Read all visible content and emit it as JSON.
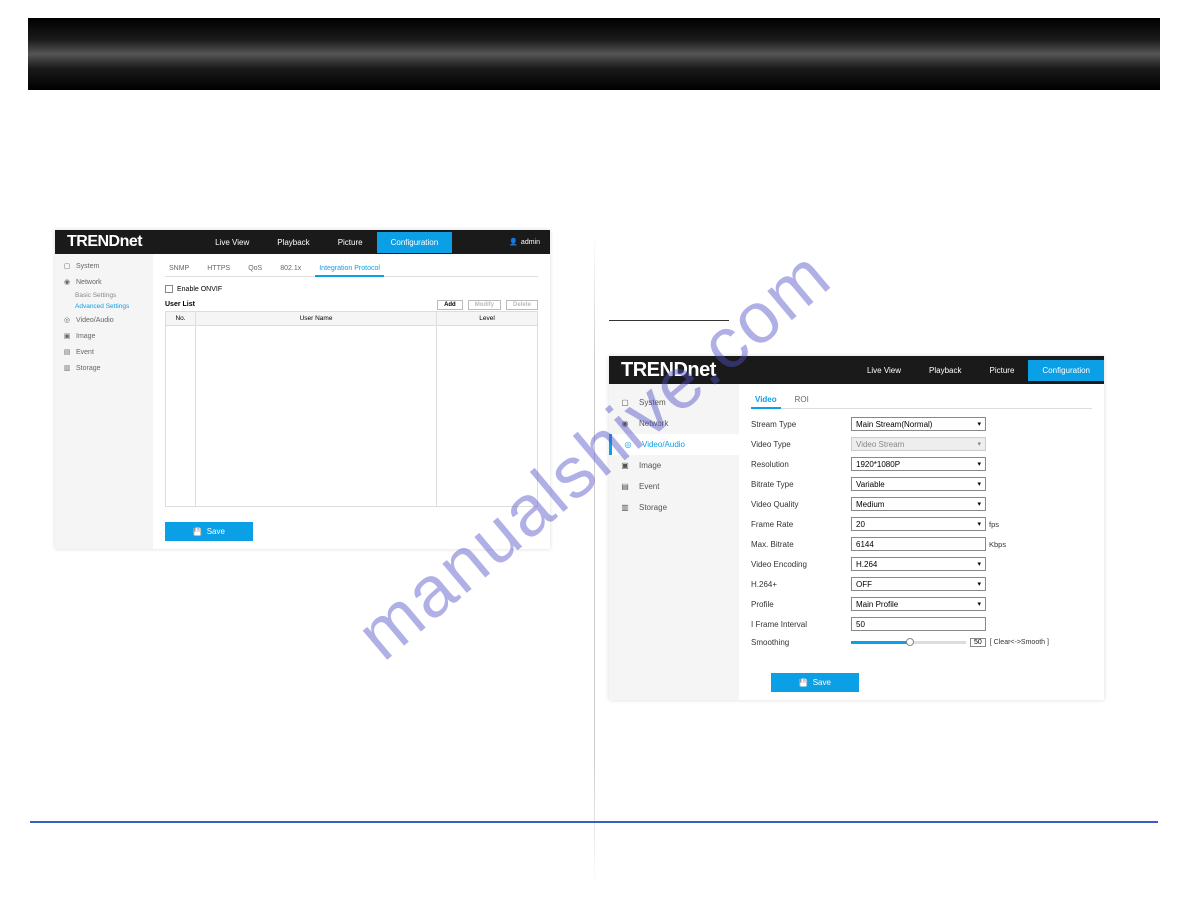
{
  "watermark_text": "manualshive.com",
  "brand_name": "TRENDnet",
  "header_tabs": {
    "live_view": "Live View",
    "playback": "Playback",
    "picture": "Picture",
    "configuration": "Configuration"
  },
  "user_label": "admin",
  "left_screenshot": {
    "sidebar": {
      "system": "System",
      "network": "Network",
      "basic_settings": "Basic Settings",
      "advanced_settings": "Advanced Settings",
      "video_audio": "Video/Audio",
      "image": "Image",
      "event": "Event",
      "storage": "Storage"
    },
    "subtabs": {
      "snmp": "SNMP",
      "https": "HTTPS",
      "qos": "QoS",
      "dot1x": "802.1x",
      "integration": "Integration Protocol"
    },
    "enable_onvif": "Enable ONVIF",
    "user_list_label": "User List",
    "add_btn": "Add",
    "modify_btn": "Modify",
    "delete_btn": "Delete",
    "table": {
      "no": "No.",
      "username": "User Name",
      "level": "Level"
    },
    "save": "Save"
  },
  "right_screenshot": {
    "sidebar": {
      "system": "System",
      "network": "Network",
      "video_audio": "Video/Audio",
      "image": "Image",
      "event": "Event",
      "storage": "Storage"
    },
    "subtabs": {
      "video": "Video",
      "roi": "ROI"
    },
    "form": {
      "stream_type": {
        "label": "Stream Type",
        "value": "Main Stream(Normal)"
      },
      "video_type": {
        "label": "Video Type",
        "value": "Video Stream"
      },
      "resolution": {
        "label": "Resolution",
        "value": "1920*1080P"
      },
      "bitrate_type": {
        "label": "Bitrate Type",
        "value": "Variable"
      },
      "video_quality": {
        "label": "Video Quality",
        "value": "Medium"
      },
      "frame_rate": {
        "label": "Frame Rate",
        "value": "20",
        "unit": "fps"
      },
      "max_bitrate": {
        "label": "Max. Bitrate",
        "value": "6144",
        "unit": "Kbps"
      },
      "video_encoding": {
        "label": "Video Encoding",
        "value": "H.264"
      },
      "h264plus": {
        "label": "H.264+",
        "value": "OFF"
      },
      "profile": {
        "label": "Profile",
        "value": "Main Profile"
      },
      "iframe": {
        "label": "I Frame Interval",
        "value": "50"
      },
      "smoothing": {
        "label": "Smoothing",
        "value": "50",
        "hint": "[ Clear<->Smooth ]"
      }
    },
    "save": "Save"
  }
}
